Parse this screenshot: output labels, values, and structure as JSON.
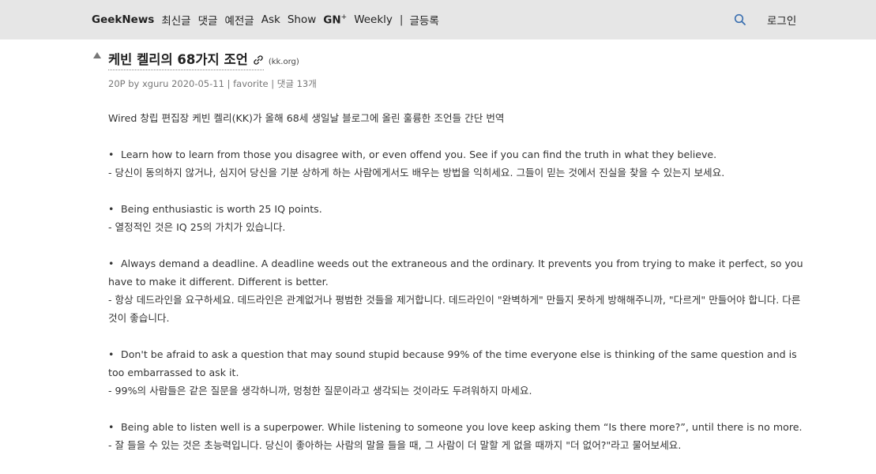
{
  "nav": {
    "brand": "GeekNews",
    "items": [
      "최신글",
      "댓글",
      "예전글",
      "Ask",
      "Show"
    ],
    "gn": "GN",
    "gn_sup": "+",
    "weekly": "Weekly",
    "separator": "|",
    "submit": "글등록",
    "login": "로그인",
    "search_icon": "search-icon"
  },
  "story": {
    "title": "케빈 켈리의 68가지 조언",
    "domain": "(kk.org)",
    "meta": {
      "points": "20P",
      "by": "by",
      "author": "xguru",
      "date": "2020-05-11",
      "sep1": "|",
      "favorite": "favorite",
      "sep2": "|",
      "comments": "댓글 13개"
    }
  },
  "content": {
    "intro": "Wired 창립 편집장 케빈 켈리(KK)가 올해 68세 생일날 블로그에 올린 훌륭한 조언들 간단 번역",
    "bullet_char": "•",
    "items": [
      {
        "en": "Learn how to learn from those you disagree with, or even offend you. See if you can find the truth in what they believe.",
        "ko": "- 당신이 동의하지 않거나, 심지어 당신을 기분 상하게 하는 사람에게서도 배우는 방법을 익히세요. 그들이 믿는 것에서 진실을 찾을 수 있는지 보세요."
      },
      {
        "en": "Being enthusiastic is worth 25 IQ points.",
        "ko": "- 열정적인 것은 IQ 25의 가치가 있습니다."
      },
      {
        "en": "Always demand a deadline. A deadline weeds out the extraneous and the ordinary. It prevents you from trying to make it perfect, so you have to make it different. Different is better.",
        "ko": "- 항상 데드라인을 요구하세요. 데드라인은 관계없거나 평범한 것들을 제거합니다. 데드라인이 \"완벽하게\" 만들지 못하게 방해해주니까, \"다르게\" 만들어야 합니다. 다른 것이 좋습니다."
      },
      {
        "en": "Don't be afraid to ask a question that may sound stupid because 99% of the time everyone else is thinking of the same question and is too embarrassed to ask it.",
        "ko": "- 99%의 사람들은 같은 질문을 생각하니까, 멍청한 질문이라고 생각되는 것이라도 두려워하지 마세요."
      },
      {
        "en": "Being able to listen well is a superpower. While listening to someone you love keep asking them “Is there more?”, until there is no more.",
        "ko": "- 잘 들을 수 있는 것은 초능력입니다. 당신이 좋아하는 사람의 말을 들을 때, 그 사람이 더 말할 게 없을 때까지 \"더 없어?\"라고 물어보세요."
      }
    ]
  }
}
